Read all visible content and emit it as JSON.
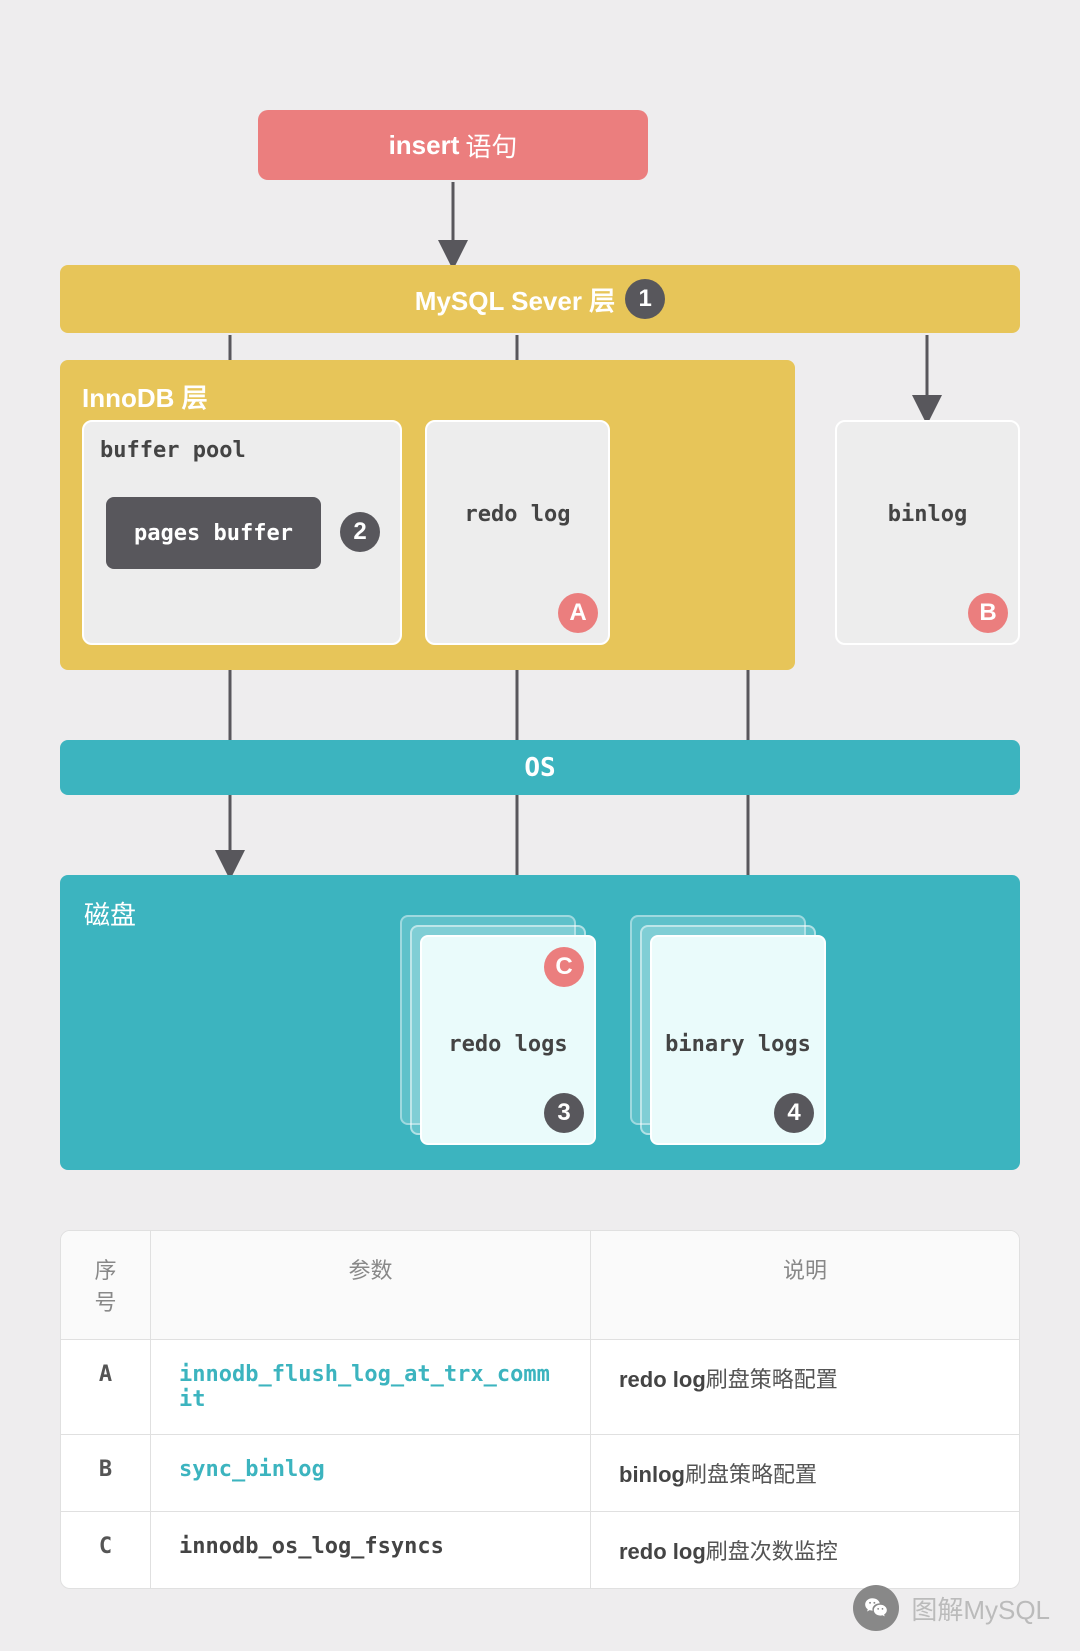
{
  "insert": {
    "bold": "insert",
    "text": "语句"
  },
  "server": {
    "label": "MySQL Sever 层",
    "badge": "1"
  },
  "innodb": {
    "label": "InnoDB 层",
    "bufferpool_label": "buffer pool",
    "pages_buffer_label": "pages buffer",
    "pages_buffer_badge": "2",
    "redo_label": "redo log",
    "redo_badge": "A",
    "binlog_label": "binlog",
    "binlog_badge": "B"
  },
  "os": {
    "label": "OS"
  },
  "disk": {
    "label": "磁盘",
    "redo_label": "redo logs",
    "redo_badge_top": "C",
    "redo_badge_bottom": "3",
    "binary_label": "binary logs",
    "binary_badge": "4"
  },
  "table": {
    "headers": {
      "seq": "序号",
      "param": "参数",
      "desc": "说明"
    },
    "rows": [
      {
        "seq": "A",
        "param": "innodb_flush_log_at_trx_commit",
        "bold": "redo log",
        "desc": "刷盘策略配置",
        "link": true
      },
      {
        "seq": "B",
        "param": "sync_binlog",
        "bold": "binlog",
        "desc": "刷盘策略配置",
        "link": true
      },
      {
        "seq": "C",
        "param": "innodb_os_log_fsyncs",
        "bold": "redo log",
        "desc": "刷盘次数监控",
        "link": false
      }
    ]
  },
  "watermark": {
    "text": "图解MySQL"
  }
}
